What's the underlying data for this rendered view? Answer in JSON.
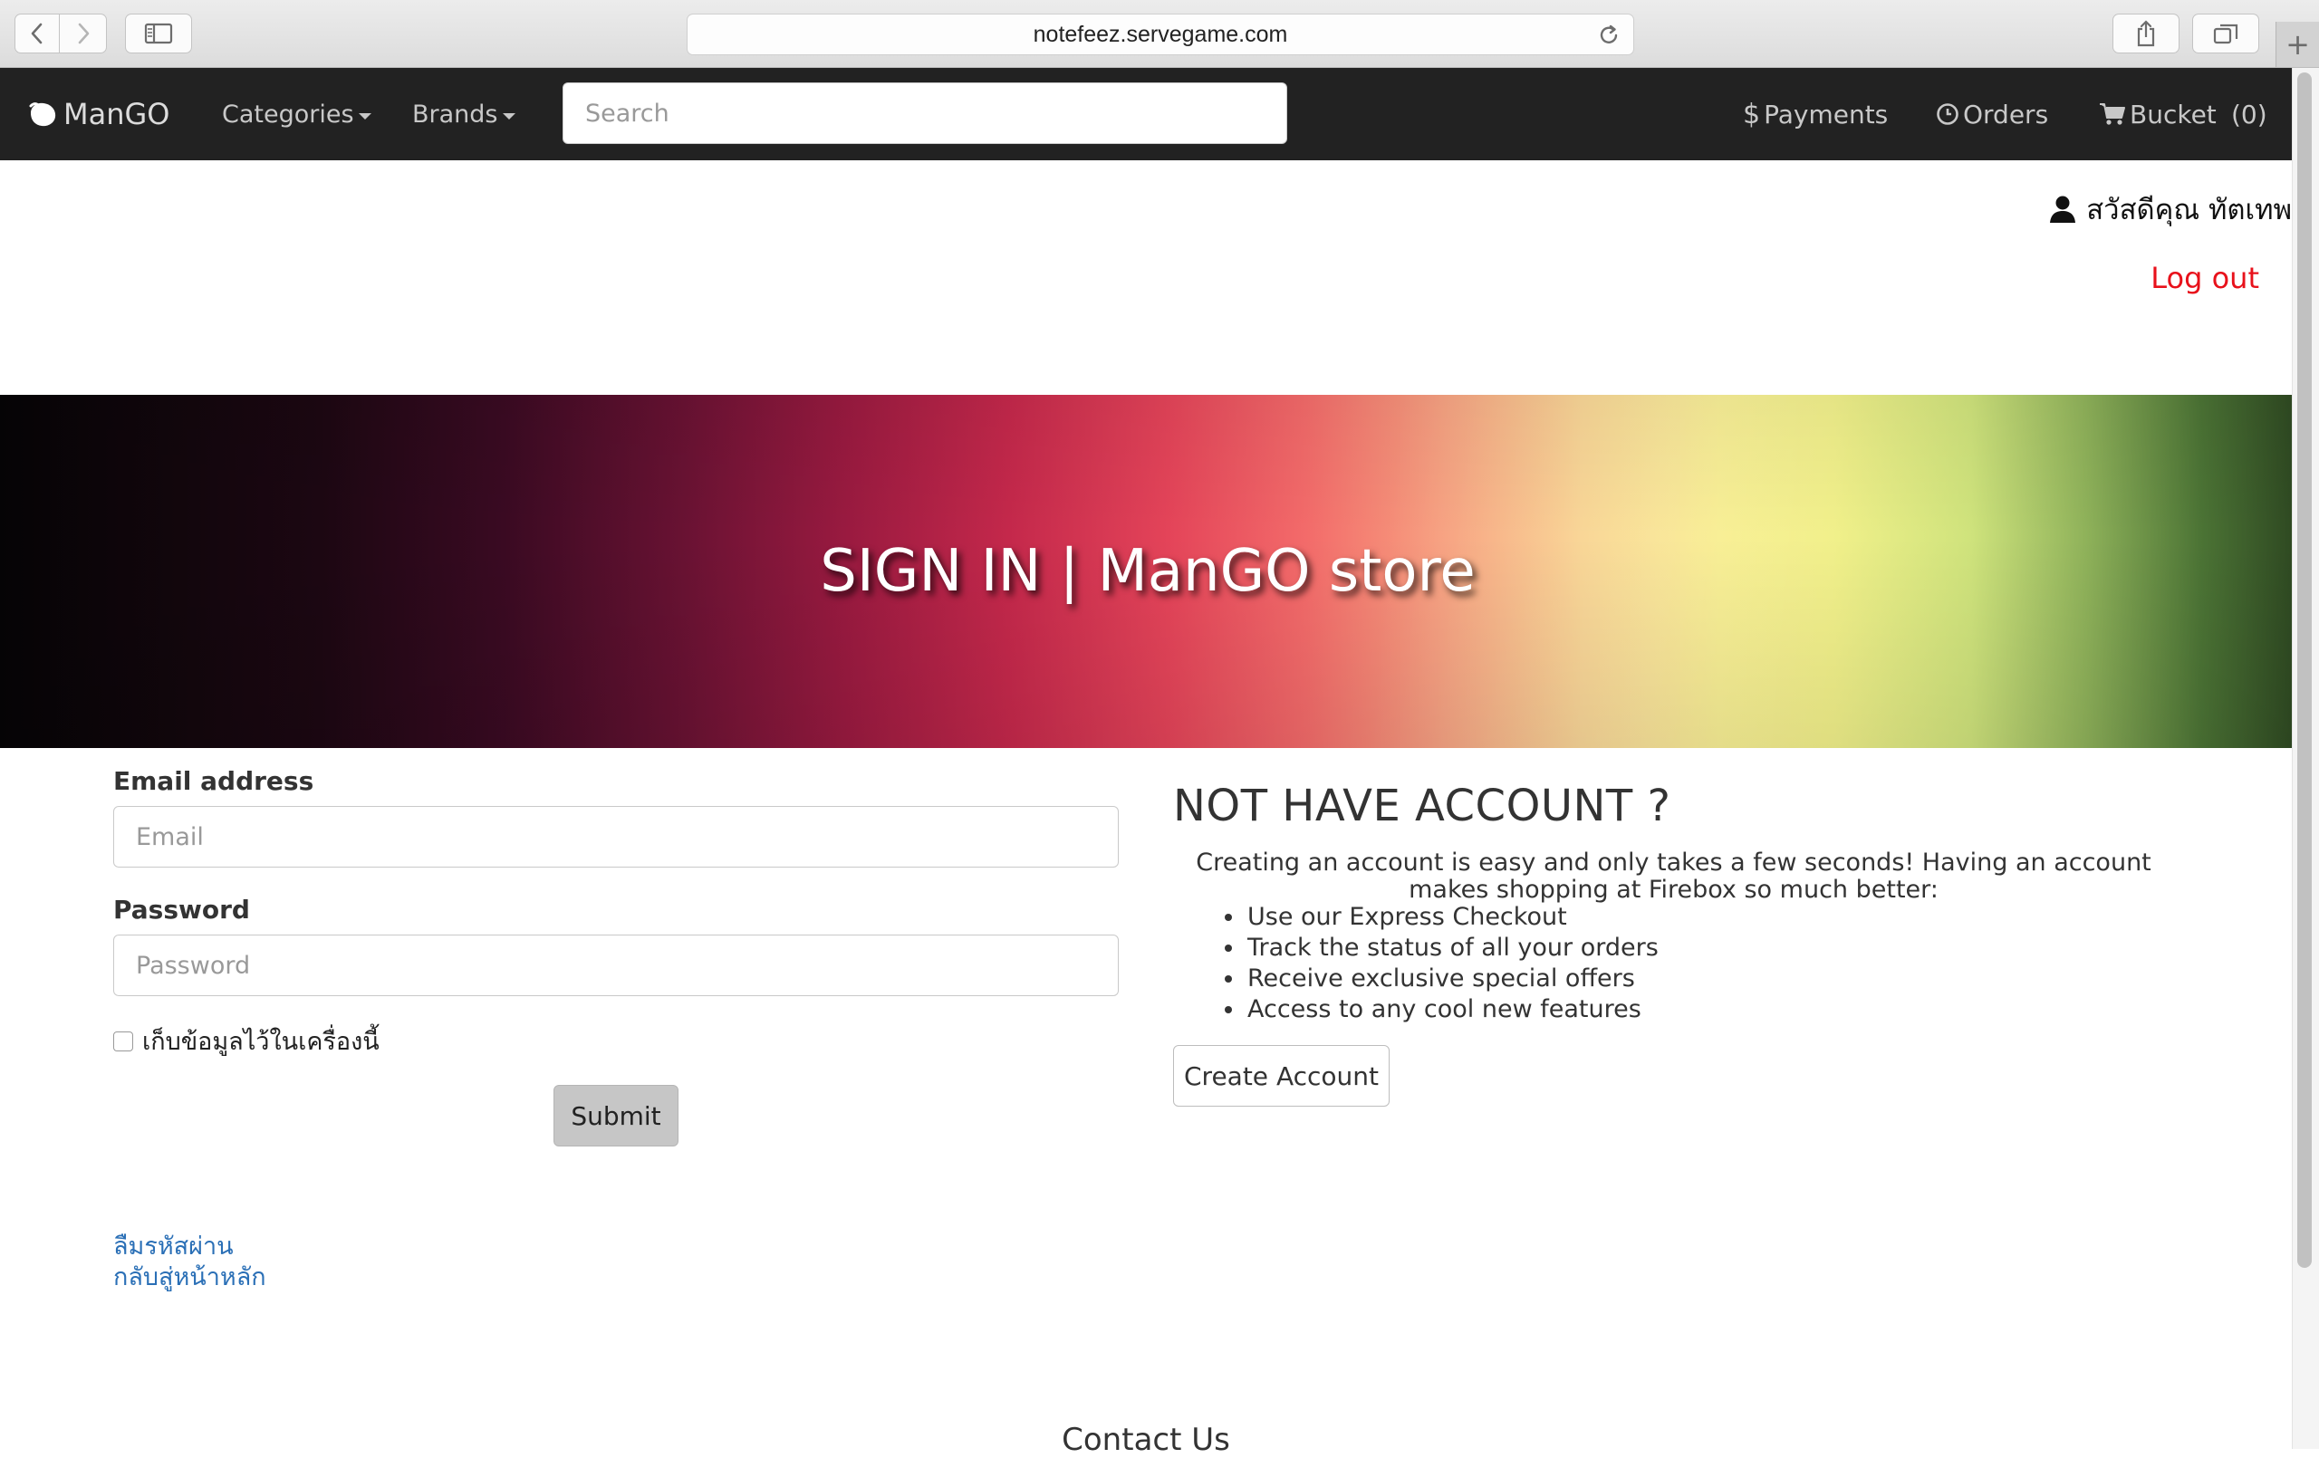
{
  "browser": {
    "url": "notefeez.servegame.com",
    "new_tab_symbol": "+"
  },
  "navbar": {
    "brand": "ManGO",
    "categories": "Categories",
    "brands": "Brands",
    "search_placeholder": "Search",
    "payments": "Payments",
    "orders": "Orders",
    "bucket": "Bucket",
    "bucket_count": "(0)"
  },
  "user": {
    "greeting": "สวัสดีคุณ ทัตเทพ",
    "logout": "Log out"
  },
  "hero": {
    "title": "SIGN IN | ManGO store"
  },
  "signin": {
    "email_label": "Email address",
    "email_placeholder": "Email",
    "password_label": "Password",
    "password_placeholder": "Password",
    "remember": "เก็บข้อมูลไว้ในเครื่องนี้",
    "submit": "Submit",
    "forgot_password": "ลืมรหัสผ่าน",
    "back_home": "กลับสู่หน้าหลัก"
  },
  "signup": {
    "title": "NOT HAVE ACCOUNT ?",
    "description": "Creating an account is easy and only takes a few seconds! Having an account makes shopping at Firebox so much better:",
    "benefits": [
      "Use our Express Checkout",
      "Track the status of all your orders",
      "Receive exclusive special offers",
      "Access to any cool new features"
    ],
    "create_account": "Create Account"
  },
  "footer": {
    "contact_heading": "Contact Us"
  },
  "colors": {
    "navbar_bg": "#222222",
    "logout": "#e8111b",
    "link": "#2a6fb6",
    "submit_bg": "#c6c6c6"
  }
}
